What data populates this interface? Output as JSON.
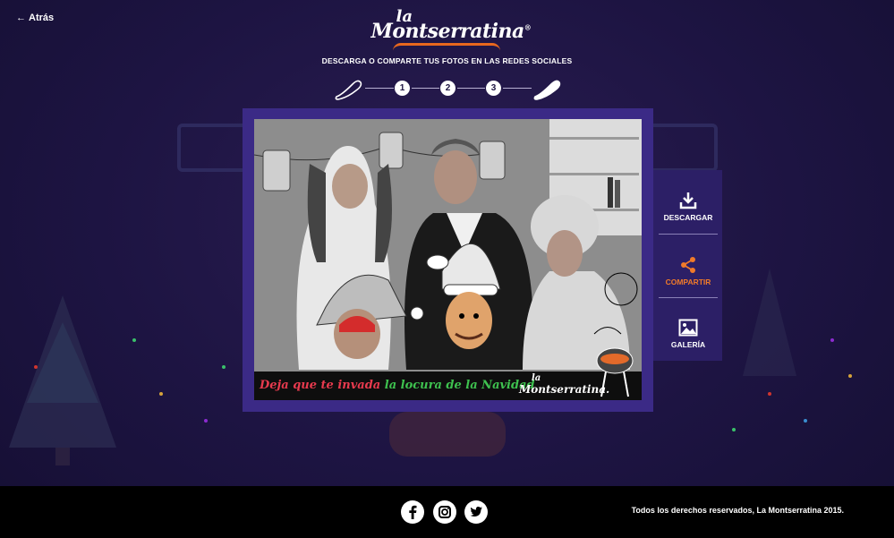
{
  "nav": {
    "back_label": "Atrás"
  },
  "logo": {
    "la": "la",
    "name": "Montserratina",
    "registered": "®"
  },
  "header": {
    "subtitle": "DESCARGA O COMPARTE TUS FOTOS EN LAS REDES SOCIALES"
  },
  "steps": [
    "1",
    "2",
    "3"
  ],
  "photo": {
    "banner_part1": "Deja que te invada",
    "banner_part2": "la locura de la Navidad",
    "banner_logo_la": "la",
    "banner_logo_name": "Montserratina."
  },
  "actions": [
    {
      "label": "DESCARGAR",
      "icon": "download-icon",
      "active": false
    },
    {
      "label": "COMPARTIR",
      "icon": "share-icon",
      "active": true
    },
    {
      "label": "GALERÍA",
      "icon": "gallery-icon",
      "active": false
    }
  ],
  "footer": {
    "social": [
      "facebook-icon",
      "instagram-icon",
      "twitter-icon"
    ],
    "copyright": "Todos los derechos reservados, La Montserratina 2015."
  },
  "colors": {
    "background": "#1d1442",
    "frame": "#3b2a86",
    "accent": "#f07a2a",
    "panel": "#2c1f66"
  }
}
